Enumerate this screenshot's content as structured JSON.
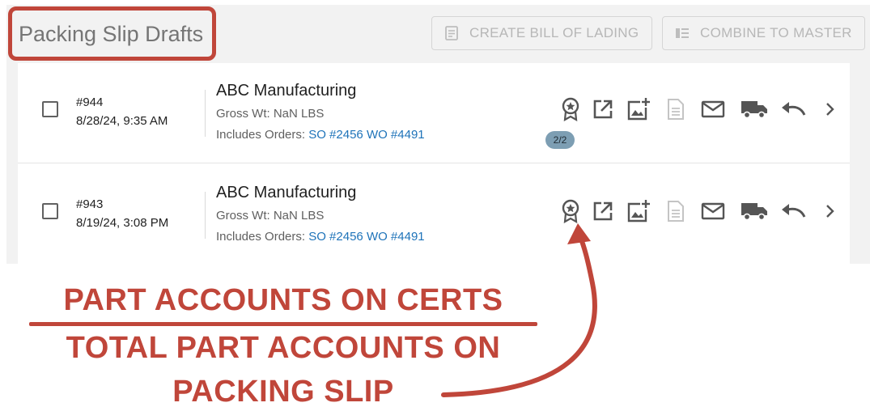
{
  "header": {
    "title": "Packing Slip Drafts",
    "buttons": [
      {
        "label": "CREATE BILL OF LADING",
        "icon": "document-icon"
      },
      {
        "label": "COMBINE TO MASTER",
        "icon": "combine-icon"
      }
    ]
  },
  "rows": [
    {
      "id": "#944",
      "date": "8/28/24, 9:35 AM",
      "company": "ABC Manufacturing",
      "gross": "Gross Wt: NaN LBS",
      "orders_label": "Includes Orders:",
      "orders_links": "SO #2456 WO #4491",
      "cert_badge": ""
    },
    {
      "id": "#943",
      "date": "8/19/24, 3:08 PM",
      "company": "ABC Manufacturing",
      "gross": "Gross Wt: NaN LBS",
      "orders_label": "Includes Orders:",
      "orders_links": "SO #2456 WO #4491",
      "cert_badge": "2/2"
    }
  ],
  "row_actions": [
    "certificate-icon",
    "open-external-icon",
    "add-image-icon",
    "document-icon",
    "email-icon",
    "truck-icon",
    "undo-icon",
    "chevron-right-icon"
  ],
  "annotation": {
    "numerator": "PART ACCOUNTS ON CERTS",
    "denominator_line1": "TOTAL PART ACCOUNTS ON",
    "denominator_line2": "PACKING SLIP",
    "color": "#c0463a"
  },
  "colors": {
    "link": "#1e73b9",
    "badge": "#7d9eb3",
    "panel_bg": "#f2f2f2"
  }
}
